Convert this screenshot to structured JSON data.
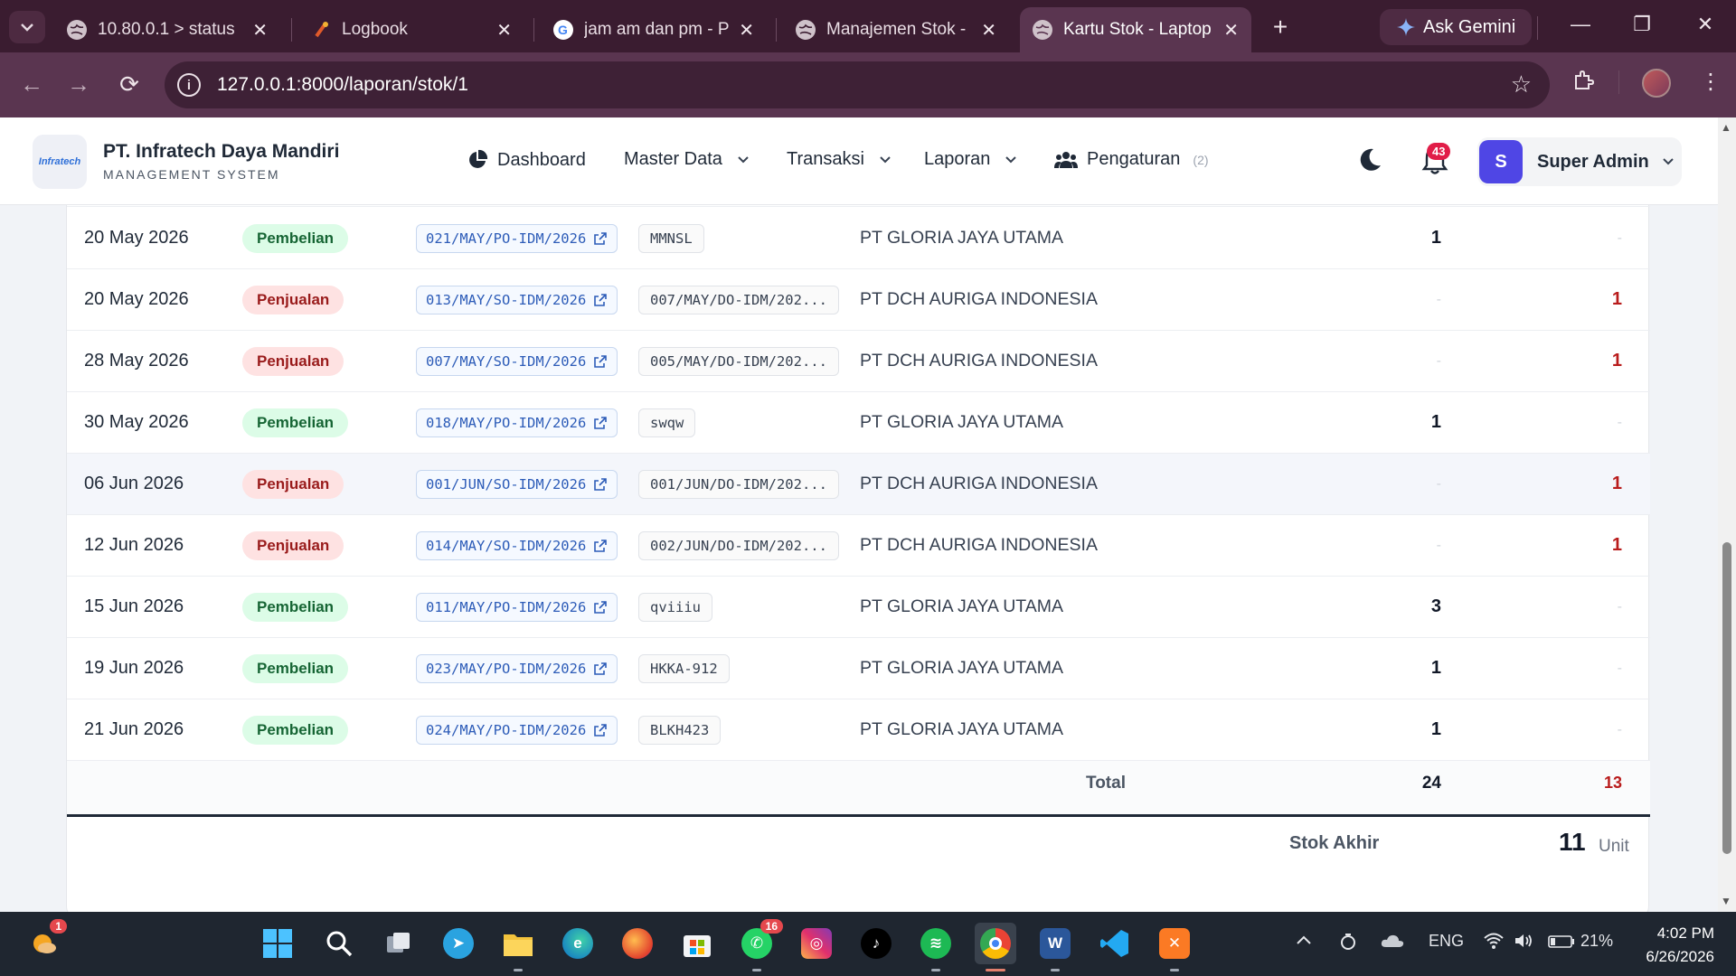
{
  "browser": {
    "tabs": [
      {
        "title": "10.80.0.1 > status",
        "active": false
      },
      {
        "title": "Logbook",
        "active": false
      },
      {
        "title": "jam am dan pm - Pe",
        "active": false
      },
      {
        "title": "Manajemen Stok - P",
        "active": false
      },
      {
        "title": "Kartu Stok - Laptop",
        "active": true
      }
    ],
    "new_tab": "+",
    "gemini_label": "Ask Gemini",
    "url": "127.0.0.1:8000/laporan/stok/1"
  },
  "app": {
    "company": "PT. Infratech Daya Mandiri",
    "subtitle": "MANAGEMENT SYSTEM",
    "logo_text": "Infratech",
    "nav": {
      "dashboard": "Dashboard",
      "master_data": "Master Data",
      "transaksi": "Transaksi",
      "laporan": "Laporan",
      "pengaturan": "Pengaturan",
      "pengaturan_count": "(2)"
    },
    "notifications": "43",
    "user_initial": "S",
    "user_name": "Super Admin"
  },
  "table": {
    "rows": [
      {
        "date": "20 May 2026",
        "type": "Pembelian",
        "ref": "021/MAY/PO-IDM/2026",
        "doc": "MMNSL",
        "party": "PT GLORIA JAYA UTAMA",
        "in": "1",
        "out": "-"
      },
      {
        "date": "20 May 2026",
        "type": "Penjualan",
        "ref": "013/MAY/SO-IDM/2026",
        "doc": "007/MAY/DO-IDM/202...",
        "party": "PT DCH AURIGA INDONESIA",
        "in": "-",
        "out": "1"
      },
      {
        "date": "28 May 2026",
        "type": "Penjualan",
        "ref": "007/MAY/SO-IDM/2026",
        "doc": "005/MAY/DO-IDM/202...",
        "party": "PT DCH AURIGA INDONESIA",
        "in": "-",
        "out": "1"
      },
      {
        "date": "30 May 2026",
        "type": "Pembelian",
        "ref": "018/MAY/PO-IDM/2026",
        "doc": "swqw",
        "party": "PT GLORIA JAYA UTAMA",
        "in": "1",
        "out": "-"
      },
      {
        "date": "06 Jun 2026",
        "type": "Penjualan",
        "ref": "001/JUN/SO-IDM/2026",
        "doc": "001/JUN/DO-IDM/202...",
        "party": "PT DCH AURIGA INDONESIA",
        "in": "-",
        "out": "1"
      },
      {
        "date": "12 Jun 2026",
        "type": "Penjualan",
        "ref": "014/MAY/SO-IDM/2026",
        "doc": "002/JUN/DO-IDM/202...",
        "party": "PT DCH AURIGA INDONESIA",
        "in": "-",
        "out": "1"
      },
      {
        "date": "15 Jun 2026",
        "type": "Pembelian",
        "ref": "011/MAY/PO-IDM/2026",
        "doc": "qviiiu",
        "party": "PT GLORIA JAYA UTAMA",
        "in": "3",
        "out": "-"
      },
      {
        "date": "19 Jun 2026",
        "type": "Pembelian",
        "ref": "023/MAY/PO-IDM/2026",
        "doc": "HKKA-912",
        "party": "PT GLORIA JAYA UTAMA",
        "in": "1",
        "out": "-"
      },
      {
        "date": "21 Jun 2026",
        "type": "Pembelian",
        "ref": "024/MAY/PO-IDM/2026",
        "doc": "BLKH423",
        "party": "PT GLORIA JAYA UTAMA",
        "in": "1",
        "out": "-"
      }
    ],
    "total_label": "Total",
    "total_in": "24",
    "total_out": "13",
    "stok_label": "Stok Akhir",
    "stok_value": "11",
    "stok_unit": "Unit"
  },
  "taskbar": {
    "weather_badge": "1",
    "whatsapp_badge": "16",
    "lang": "ENG",
    "battery": "21%",
    "time": "4:02 PM",
    "date": "6/26/2026"
  },
  "colors": {
    "tabstrip": "#3a1c30",
    "toolbar": "#5a3550",
    "purchase_pill": "#dcfce7",
    "sale_pill": "#fee2e2",
    "accent": "#4f46e5"
  }
}
